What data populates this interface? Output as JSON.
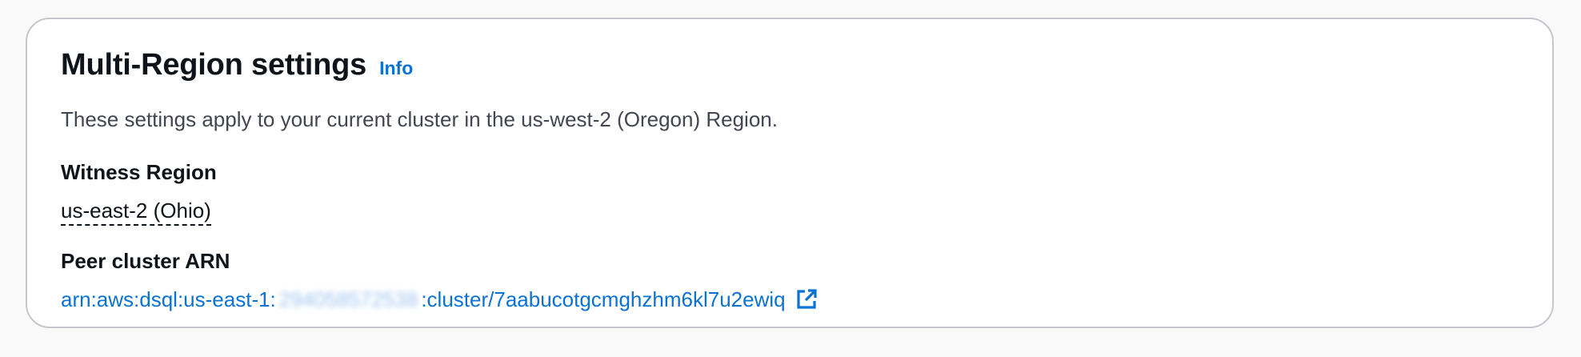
{
  "panel": {
    "title": "Multi-Region settings",
    "info_label": "Info",
    "description": "These settings apply to your current cluster in the us-west-2 (Oregon) Region."
  },
  "witness_region": {
    "label": "Witness Region",
    "value": "us-east-2 (Ohio)"
  },
  "peer_cluster": {
    "label": "Peer cluster ARN",
    "arn_prefix": "arn:aws:dsql:us-east-1:",
    "account_id": "294058572538",
    "arn_suffix": ":cluster/7aabucotgcmghzhm6kl7u2ewiq",
    "link_icon": "external-link-icon"
  },
  "colors": {
    "link": "#0972d3",
    "border": "#c6c6cd",
    "background": "#f9f9f9"
  }
}
